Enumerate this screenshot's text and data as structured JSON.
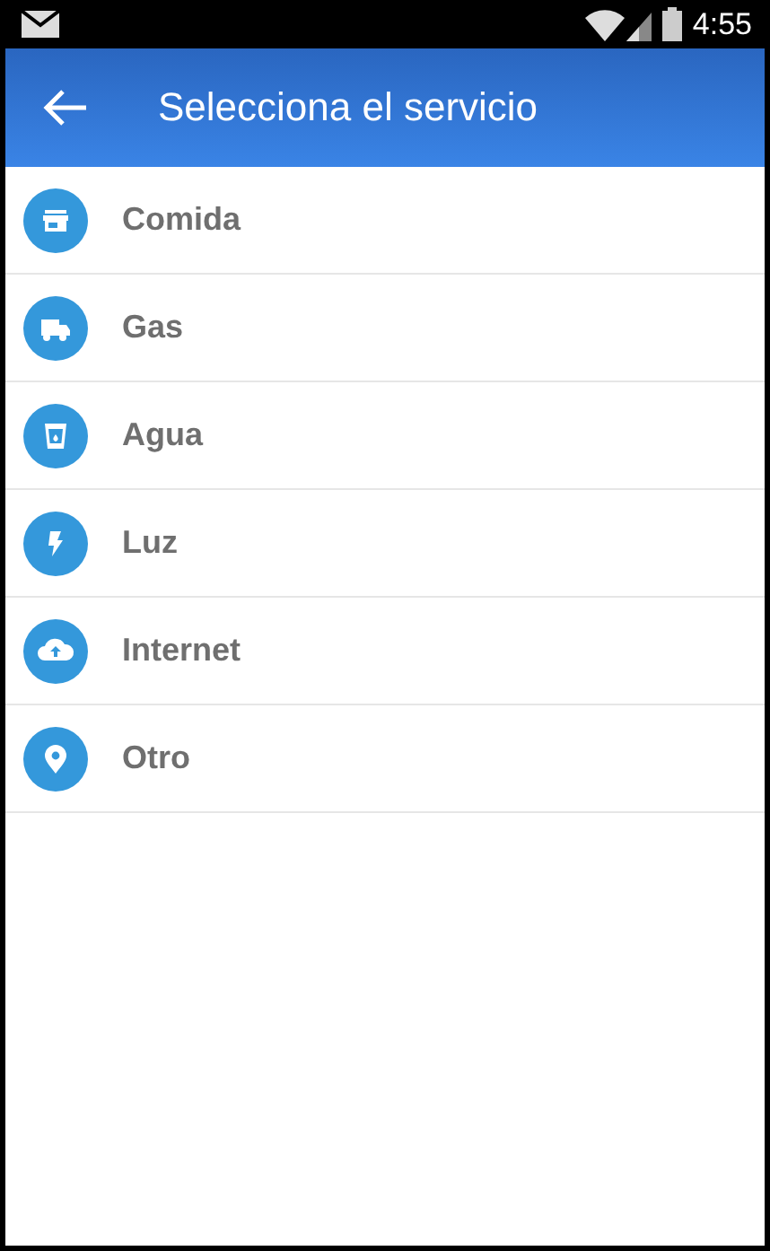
{
  "status_bar": {
    "time": "4:55"
  },
  "toolbar": {
    "title": "Selecciona el servicio"
  },
  "services": [
    {
      "label": "Comida",
      "kind": "store"
    },
    {
      "label": "Gas",
      "kind": "truck"
    },
    {
      "label": "Agua",
      "kind": "cup"
    },
    {
      "label": "Luz",
      "kind": "bolt"
    },
    {
      "label": "Internet",
      "kind": "cloud"
    },
    {
      "label": "Otro",
      "kind": "pin"
    }
  ]
}
